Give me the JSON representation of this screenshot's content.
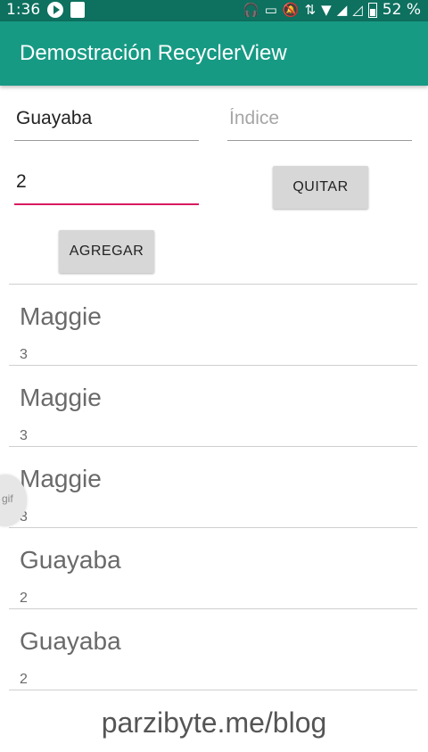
{
  "status_bar": {
    "time": "1:36",
    "battery_text": "52 %",
    "icons": [
      "play-icon",
      "stop-icon",
      "headset-icon",
      "cast-icon",
      "mute-icon",
      "data-arrows-icon",
      "wifi-icon",
      "signal-icon",
      "signal-empty-icon",
      "battery-icon"
    ]
  },
  "app_bar": {
    "title": "Demostración RecyclerView",
    "color": "#179a84"
  },
  "form": {
    "name_value": "Guayaba",
    "index_placeholder": "Índice",
    "index_value": "",
    "remove_index_value": "2",
    "remove_button": "QUITAR",
    "add_button": "AGREGAR",
    "accent_color": "#d81b60"
  },
  "list": {
    "items": [
      {
        "name": "Maggie",
        "index": "3"
      },
      {
        "name": "Maggie",
        "index": "3"
      },
      {
        "name": "Maggie",
        "index": "3"
      },
      {
        "name": "Guayaba",
        "index": "2"
      },
      {
        "name": "Guayaba",
        "index": "2"
      }
    ]
  },
  "overlay": {
    "gif_label": "gif"
  },
  "footer": {
    "text": "parzibyte.me/blog"
  }
}
